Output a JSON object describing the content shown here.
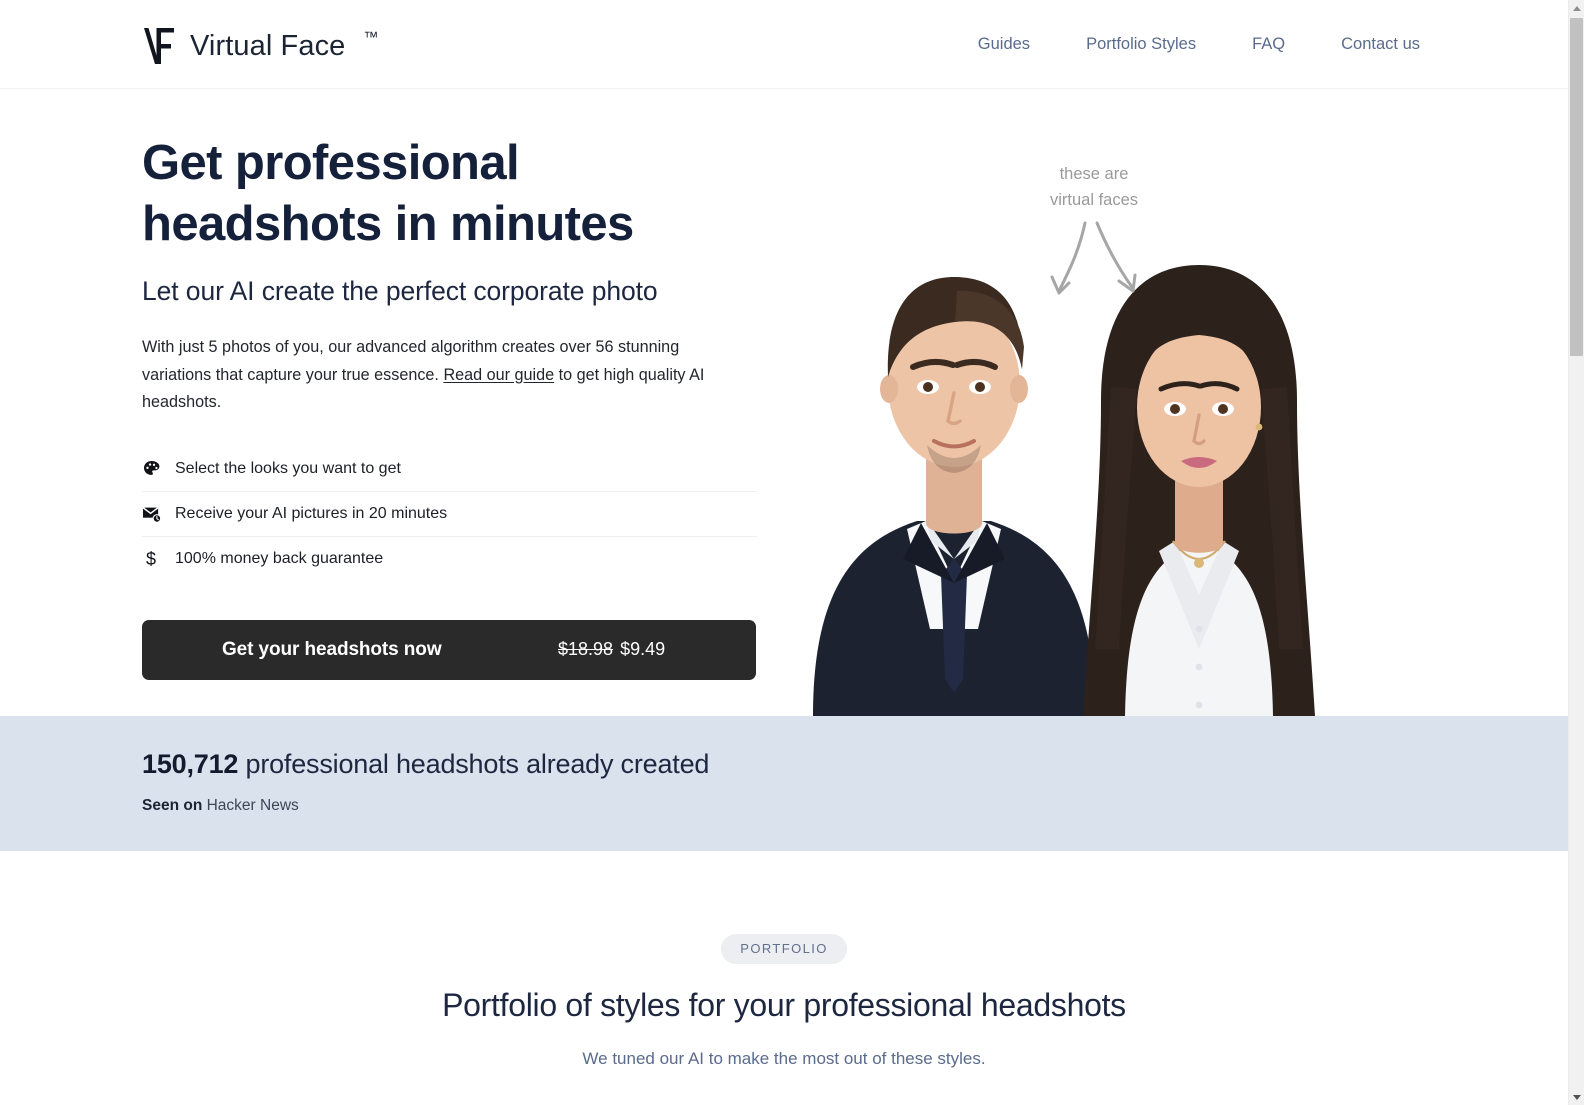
{
  "header": {
    "logo_icon": "vf-monogram-logo",
    "brand_name": "Virtual Face",
    "trademark": "™",
    "nav": [
      {
        "label": "Guides",
        "name": "guides"
      },
      {
        "label": "Portfolio Styles",
        "name": "portfolio-styles"
      },
      {
        "label": "FAQ",
        "name": "faq"
      },
      {
        "label": "Contact us",
        "name": "contact-us"
      }
    ]
  },
  "hero": {
    "title_line1": "Get professional",
    "title_line2": "headshots in minutes",
    "subtitle": "Let our AI create the perfect corporate photo",
    "description_before": "With just 5 photos of you, our advanced algorithm creates over 56 stunning variations that capture your true essence. ",
    "description_link": "Read our guide",
    "description_after": " to get high quality AI headshots.",
    "features": [
      {
        "icon": "palette-icon",
        "label": "Select the looks you want to get"
      },
      {
        "icon": "mail-clock-icon",
        "label": "Receive your AI pictures in 20 minutes"
      },
      {
        "icon": "dollar-icon",
        "glyph": "$",
        "label": "100% money back guarantee"
      }
    ],
    "cta": {
      "label": "Get your headshots now",
      "price_old": "$18.98",
      "price_new": "$9.49",
      "background": "#2a2a2a"
    },
    "annotation": {
      "line1": "these are",
      "line2": "virtual faces",
      "color": "#9a9a9a"
    },
    "photo_alt": "virtual-headshots-couple-photo"
  },
  "stats": {
    "count": "150,712",
    "count_suffix": " professional headshots already created",
    "seen_label": "Seen on",
    "seen_source": " Hacker News",
    "background": "#dae2ee"
  },
  "portfolio": {
    "badge": "PORTFOLIO",
    "title": "Portfolio of styles for your professional headshots",
    "subtitle": "We tuned our AI to make the most out of these styles.",
    "badge_background": "#eceef2",
    "accent_text": "#5a6b8c"
  },
  "scrollbar": {
    "up_icon": "chevron-up-icon",
    "down_icon": "chevron-down-icon",
    "thumb": "scrollbar-thumb"
  }
}
